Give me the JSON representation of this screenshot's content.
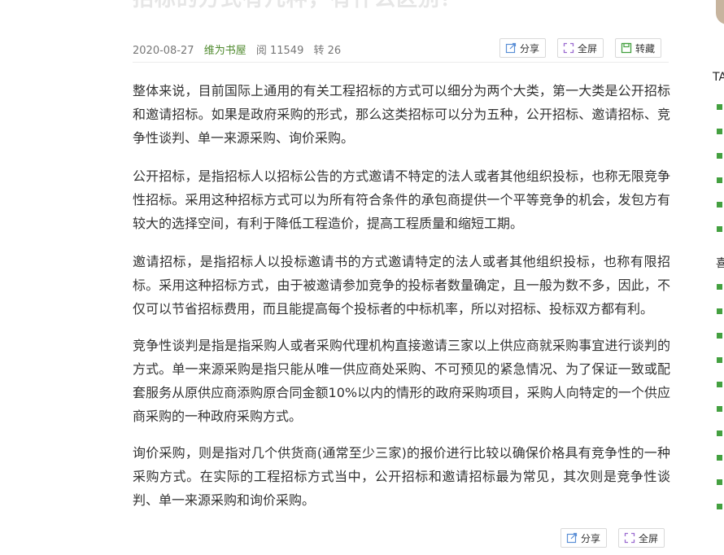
{
  "article": {
    "title": "招标的方式有几种，有什么区别？",
    "date": "2020-08-27",
    "author": "维为书屋",
    "reads": "阅 11549",
    "reposts": "转 26",
    "paragraphs": [
      "整体来说，目前国际上通用的有关工程招标的方式可以细分为两个大类，第一大类是公开招标和邀请招标。如果是政府采购的形式，那么这类招标可以分为五种，公开招标、邀请招标、竞争性谈判、单一来源采购、询价采购。",
      "公开招标，是指招标人以招标公告的方式邀请不特定的法人或者其他组织投标，也称无限竞争性招标。采用这种招标方式可以为所有符合条件的承包商提供一个平等竞争的机会，发包方有较大的选择空间，有利于降低工程造价，提高工程质量和缩短工期。",
      "邀请招标，是指招标人以投标邀请书的方式邀请特定的法人或者其他组织投标，也称有限招标。采用这种招标方式，由于被邀请参加竞争的投标者数量确定，且一般为数不多，因此，不仅可以节省招标费用，而且能提高每个投标者的中标机率，所以对招标、投标双方都有利。",
      "竞争性谈判是指是指采购人或者采购代理机构直接邀请三家以上供应商就采购事宜进行谈判的方式。单一来源采购是指只能从唯一供应商处采购、不可预见的紧急情况、为了保证一致或配套服务从原供应商添购原合同金额10%以内的情形的政府采购项目，采购人向特定的一个供应商采购的一种政府采购方式。",
      "询价采购，则是指对几个供货商(通常至少三家)的报价进行比较以确保价格具有竞争性的一种采购方式。在实际的工程招标方式当中，公开招标和邀请招标最为常见，其次则是竞争性谈判、单一来源采购和询价采购。"
    ]
  },
  "toolbar_top": {
    "share": "分享",
    "fullscreen": "全屏",
    "save": "转藏"
  },
  "toolbar_bottom": {
    "share": "分享",
    "fullscreen": "全屏"
  },
  "sidebar": {
    "label1": "TA",
    "label2": "喜"
  },
  "colors": {
    "accent_green": "#44a040",
    "author_green": "#4f8a2e"
  }
}
